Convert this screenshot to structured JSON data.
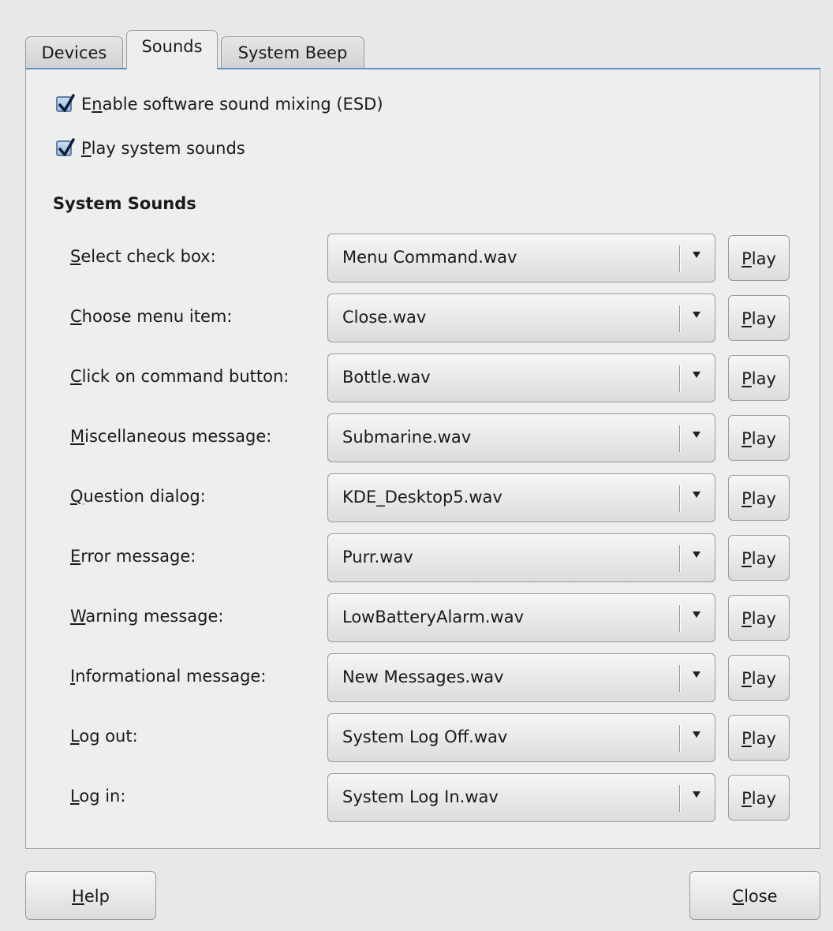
{
  "tabs": [
    {
      "label": "Devices",
      "active": false
    },
    {
      "label": "Sounds",
      "active": true
    },
    {
      "label": "System Beep",
      "active": false
    }
  ],
  "options": {
    "enable_esd": {
      "label": "Enable software sound mixing (ESD)",
      "checked": true,
      "mnemonic_index": 1
    },
    "play_system_sounds": {
      "label": "Play system sounds",
      "checked": true,
      "mnemonic_index": 0
    }
  },
  "section_title": "System Sounds",
  "sounds": [
    {
      "label": "Select check box:",
      "value": "Menu Command.wav"
    },
    {
      "label": "Choose menu item:",
      "value": "Close.wav"
    },
    {
      "label": "Click on command button:",
      "value": "Bottle.wav"
    },
    {
      "label": "Miscellaneous message:",
      "value": "Submarine.wav"
    },
    {
      "label": "Question dialog:",
      "value": "KDE_Desktop5.wav"
    },
    {
      "label": "Error message:",
      "value": "Purr.wav"
    },
    {
      "label": "Warning message:",
      "value": "LowBatteryAlarm.wav"
    },
    {
      "label": "Informational message:",
      "value": "New Messages.wav"
    },
    {
      "label": "Log out:",
      "value": "System Log Off.wav"
    },
    {
      "label": "Log in:",
      "value": "System Log In.wav"
    }
  ],
  "play_label": "Play",
  "buttons": {
    "help": "Help",
    "close": "Close"
  },
  "colors": {
    "tab_accent": "#5f93c6",
    "checkbox_fill": "#9cbde0"
  }
}
